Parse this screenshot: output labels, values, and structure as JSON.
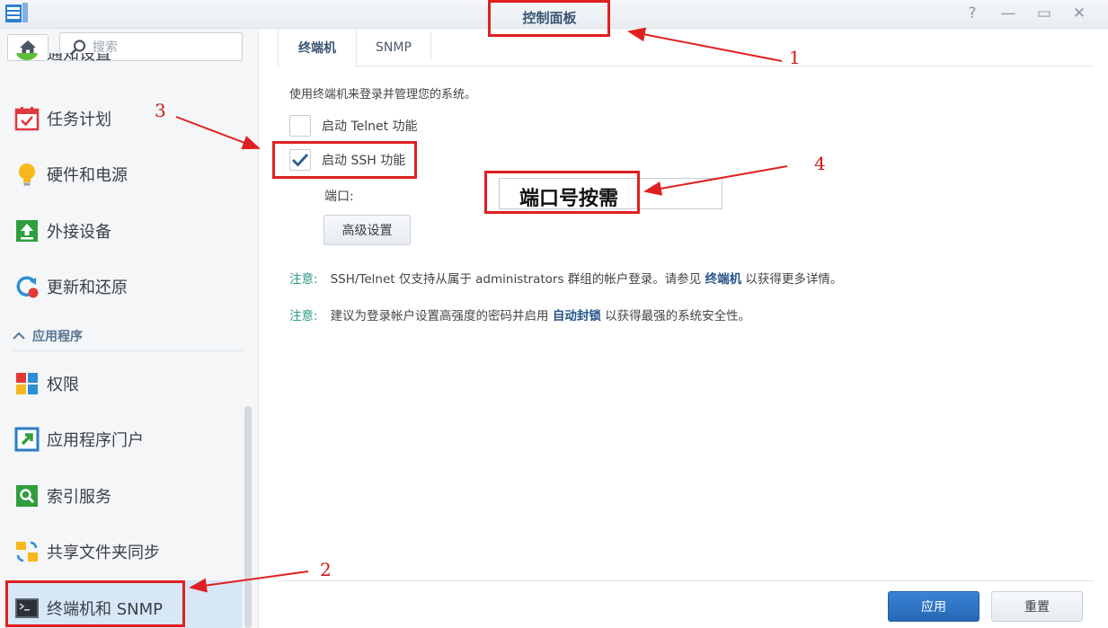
{
  "window": {
    "title": "控制面板",
    "controls": [
      "?",
      "—",
      "▭",
      "✕"
    ]
  },
  "sidebar": {
    "search_placeholder": "搜索",
    "items": [
      {
        "label": "通知设置",
        "icon": "chat-icon"
      },
      {
        "label": "任务计划",
        "icon": "calendar-check-icon"
      },
      {
        "label": "硬件和电源",
        "icon": "bulb-icon"
      },
      {
        "label": "外接设备",
        "icon": "upload-icon"
      },
      {
        "label": "更新和还原",
        "icon": "refresh-icon"
      }
    ],
    "section": "应用程序",
    "app_items": [
      {
        "label": "权限",
        "icon": "grid-icon"
      },
      {
        "label": "应用程序门户",
        "icon": "portal-icon"
      },
      {
        "label": "索引服务",
        "icon": "search-index-icon"
      },
      {
        "label": "共享文件夹同步",
        "icon": "folder-sync-icon"
      },
      {
        "label": "终端机和 SNMP",
        "icon": "terminal-icon"
      }
    ]
  },
  "tabs": [
    "终端机",
    "SNMP"
  ],
  "main": {
    "description": "使用终端机来登录并管理您的系统。",
    "telnet_label": "启动 Telnet 功能",
    "telnet_checked": false,
    "ssh_label": "启动 SSH 功能",
    "ssh_checked": true,
    "port_label": "端口:",
    "port_value": "端口号按需",
    "advanced_button": "高级设置",
    "note1": {
      "tag": "注意:",
      "text_a": "SSH/Telnet 仅支持从属于 administrators 群组的帐户登录。请参见",
      "link": "终端机",
      "text_b": "以获得更多详情。"
    },
    "note2": {
      "tag": "注意:",
      "text_a": "建议为登录帐户设置高强度的密码并启用",
      "link": "自动封锁",
      "text_b": "以获得最强的系统安全性。"
    }
  },
  "footer": {
    "apply": "应用",
    "reset": "重置"
  },
  "annotations": [
    "1",
    "2",
    "3",
    "4"
  ],
  "colors": {
    "annotation_red": "#e02020",
    "accent_blue": "#2668b6",
    "note_green": "#2e9a83"
  }
}
